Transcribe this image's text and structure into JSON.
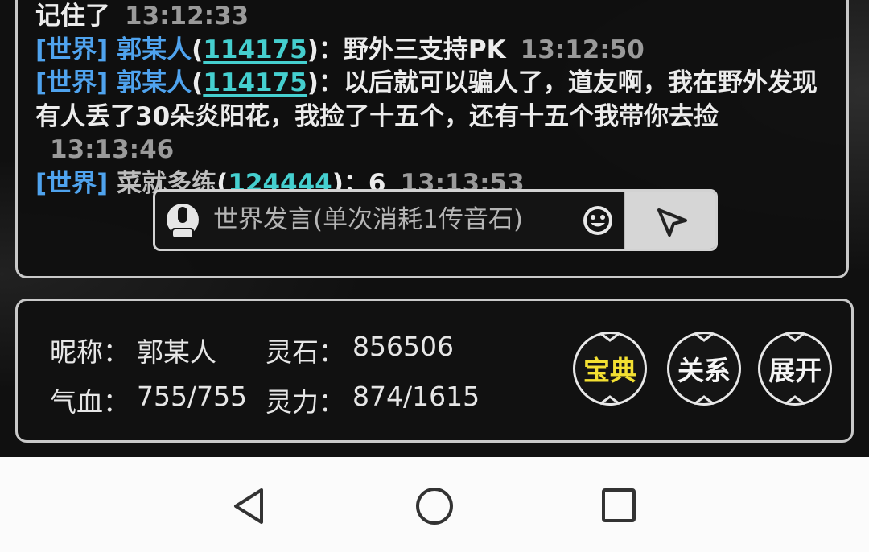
{
  "chat": {
    "lines": [
      {
        "parts": {
          "message": "记住了",
          "time": "13:12:33"
        }
      },
      {
        "parts": {
          "channel": "[世界]",
          "name": "郭某人",
          "open_paren": "(",
          "uid": "114175",
          "close_sep": ")：",
          "message": "野外三支持PK",
          "time": "13:12:50"
        }
      },
      {
        "parts": {
          "channel": "[世界]",
          "name": "郭某人",
          "open_paren": "(",
          "uid": "114175",
          "close_sep": ")：",
          "message": "以后就可以骗人了，道友啊，我在野外发现有人丢了30朵炎阳花，我捡了十五个，还有十五个我带你去捡",
          "time": "13:13:46"
        }
      },
      {
        "parts": {
          "channel": "[世界]",
          "name": "菜就多练",
          "open_paren": "(",
          "uid": "124444",
          "close_sep": ")：",
          "message": "6",
          "time": "13:13:53"
        }
      }
    ],
    "input": {
      "placeholder": "世界发言(单次消耗1传音石)"
    }
  },
  "status": {
    "nickname_label": "昵称：",
    "nickname_value": "郭某人",
    "stones_label": "灵石：",
    "stones_value": "856506",
    "hp_label": "气血：",
    "hp_value": "755/755",
    "mana_label": "灵力：",
    "mana_value": "874/1615"
  },
  "buttons": {
    "treasure": "宝典",
    "relations": "关系",
    "expand": "展开"
  },
  "colors": {
    "channel": "#4fa3ee",
    "uid": "#45cfcf",
    "gold": "#f3e032"
  },
  "nav": {
    "back_icon": "back-triangle-icon",
    "home_icon": "home-circle-icon",
    "recents_icon": "recents-square-icon"
  }
}
